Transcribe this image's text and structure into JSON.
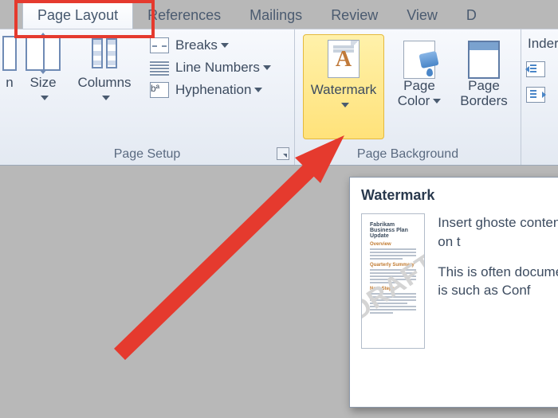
{
  "tabs": {
    "page_layout": "Page Layout",
    "references": "References",
    "mailings": "Mailings",
    "review": "Review",
    "view": "View",
    "last_partial": "D"
  },
  "groups": {
    "page_setup": "Page Setup",
    "page_background": "Page Background"
  },
  "page_setup": {
    "size": "Size",
    "columns": "Columns",
    "breaks": "Breaks",
    "line_numbers": "Line Numbers",
    "hyphenation": "Hyphenation"
  },
  "page_background": {
    "watermark": "Watermark",
    "page_color": "Page\nColor",
    "page_borders": "Page\nBorders"
  },
  "next_group": {
    "indent": "Inder"
  },
  "partial_left_button": "n",
  "tooltip": {
    "title": "Watermark",
    "thumb_title": "Fabrikam Business Plan Update",
    "draft": "DRAFT",
    "p1": "Insert ghoste content on t",
    "p2": "This is often document is such as Conf"
  }
}
